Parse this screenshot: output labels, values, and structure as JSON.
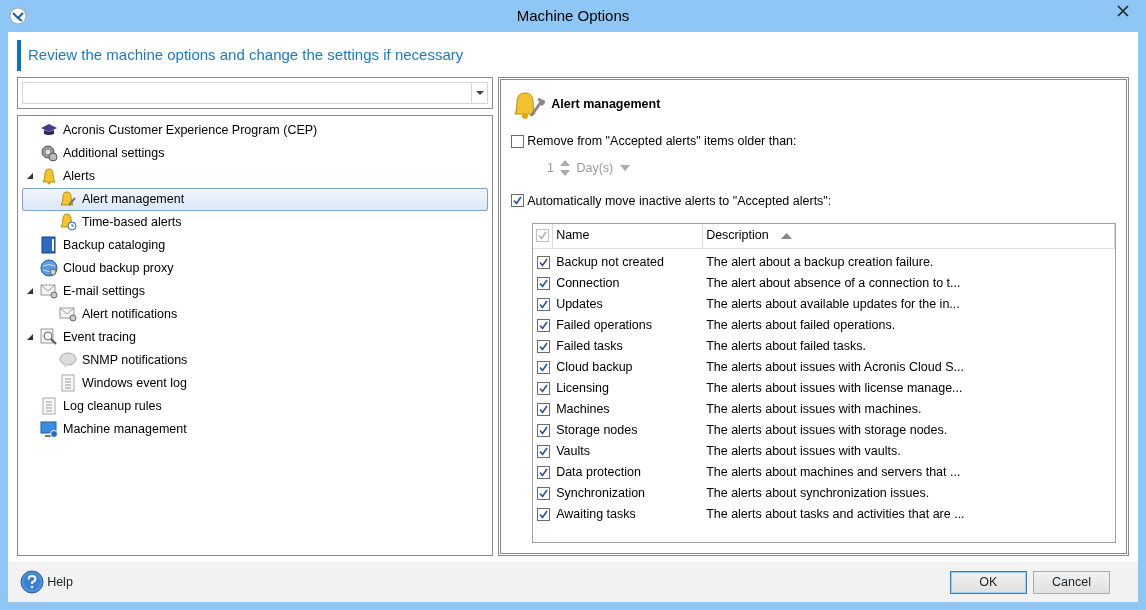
{
  "window": {
    "title": "Machine Options"
  },
  "header": "Review the machine options and change the settings if necessary",
  "tree": [
    {
      "label": "Acronis Customer Experience Program (CEP)",
      "kind": "cap",
      "selected": false
    },
    {
      "label": "Additional settings",
      "kind": "gears",
      "selected": false
    },
    {
      "label": "Alerts",
      "kind": "bell",
      "selected": false,
      "expanded": true,
      "children": [
        {
          "label": "Alert management",
          "kind": "bellwrench",
          "selected": true
        },
        {
          "label": "Time-based alerts",
          "kind": "bellclock",
          "selected": false
        }
      ]
    },
    {
      "label": "Backup cataloging",
      "kind": "book",
      "selected": false
    },
    {
      "label": "Cloud backup proxy",
      "kind": "globe",
      "selected": false
    },
    {
      "label": "E-mail settings",
      "kind": "mail",
      "selected": false,
      "expanded": true,
      "children": [
        {
          "label": "Alert notifications",
          "kind": "mail",
          "selected": false
        }
      ]
    },
    {
      "label": "Event tracing",
      "kind": "magnifier",
      "selected": false,
      "expanded": true,
      "children": [
        {
          "label": "SNMP notifications",
          "kind": "bubble",
          "selected": false
        },
        {
          "label": "Windows event log",
          "kind": "doc",
          "selected": false
        }
      ]
    },
    {
      "label": "Log cleanup rules",
      "kind": "doc",
      "selected": false
    },
    {
      "label": "Machine management",
      "kind": "monitor",
      "selected": false
    }
  ],
  "panel": {
    "title": "Alert management",
    "remove_option": {
      "label": "Remove from \"Accepted alerts\" items older than:",
      "checked": false
    },
    "age": {
      "value": "1",
      "unit": "Day(s)",
      "disabled": true
    },
    "move_option": {
      "label": "Automatically move inactive alerts to \"Accepted alerts\":",
      "checked": true
    },
    "table": {
      "select_all": {
        "checked": true,
        "disabled": true
      },
      "columns": [
        {
          "label": "Name",
          "sorted": false
        },
        {
          "label": "Description",
          "sorted": true
        }
      ],
      "rows": [
        {
          "checked": true,
          "name": "Backup not created",
          "description": "The alert about a backup creation failure."
        },
        {
          "checked": true,
          "name": "Connection",
          "description": "The alert about absence of a connection to t..."
        },
        {
          "checked": true,
          "name": "Updates",
          "description": "The alerts about available updates for the in..."
        },
        {
          "checked": true,
          "name": "Failed operations",
          "description": "The alerts about failed operations."
        },
        {
          "checked": true,
          "name": "Failed tasks",
          "description": "The alerts about failed tasks."
        },
        {
          "checked": true,
          "name": "Cloud backup",
          "description": "The alerts about issues with Acronis Cloud S..."
        },
        {
          "checked": true,
          "name": "Licensing",
          "description": "The alerts about issues with license manage..."
        },
        {
          "checked": true,
          "name": "Machines",
          "description": "The alerts about issues with machines."
        },
        {
          "checked": true,
          "name": "Storage nodes",
          "description": "The alerts about issues with storage nodes."
        },
        {
          "checked": true,
          "name": "Vaults",
          "description": "The alerts about issues with vaults."
        },
        {
          "checked": true,
          "name": "Data protection",
          "description": "The alerts about machines and servers that ..."
        },
        {
          "checked": true,
          "name": "Synchronization",
          "description": "The alerts about synchronization issues."
        },
        {
          "checked": true,
          "name": "Awaiting tasks",
          "description": "The alerts about tasks and activities that are ..."
        }
      ]
    }
  },
  "footer": {
    "help": "Help",
    "buttons": [
      {
        "label": "OK",
        "default": true
      },
      {
        "label": "Cancel",
        "default": false
      }
    ]
  }
}
